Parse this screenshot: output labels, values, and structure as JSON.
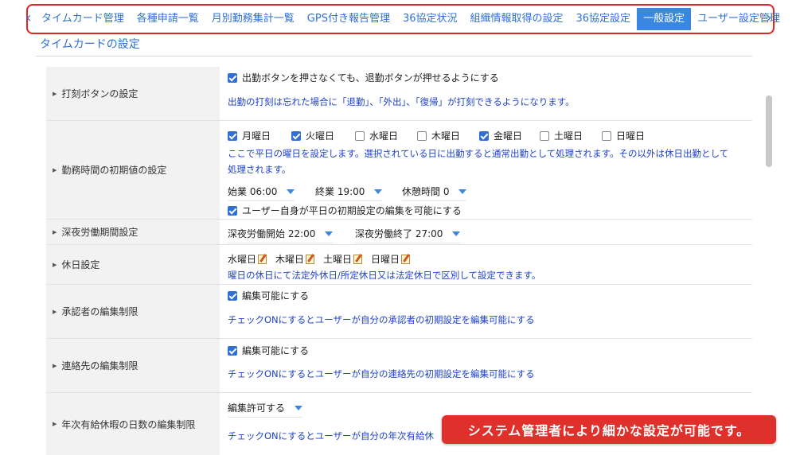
{
  "tabs": [
    {
      "label": "タイムカード管理",
      "active": false
    },
    {
      "label": "各種申請一覧",
      "active": false
    },
    {
      "label": "月別勤務集計一覧",
      "active": false
    },
    {
      "label": "GPS付き報告管理",
      "active": false
    },
    {
      "label": "36協定状況",
      "active": false
    },
    {
      "label": "組織情報取得の設定",
      "active": false
    },
    {
      "label": "36協定設定",
      "active": false
    },
    {
      "label": "一般設定",
      "active": true
    },
    {
      "label": "ユーザー設定管理",
      "active": false
    }
  ],
  "nav": {
    "left_icon": "chevron-left-icon",
    "right_icon": "chevron-right-icon"
  },
  "section_title": "タイムカードの設定",
  "rows": {
    "punch": {
      "label": "打刻ボタンの設定",
      "checkbox_label": "出勤ボタンを押さなくても、退勤ボタンが押せるようにする",
      "checked": true,
      "note": "出勤の打刻は忘れた場合に「退勤」、「外出」、「復帰」が打刻できるようになります。"
    },
    "worktime": {
      "label": "勤務時間の初期値の設定",
      "days": [
        {
          "label": "月曜日",
          "checked": true
        },
        {
          "label": "火曜日",
          "checked": true
        },
        {
          "label": "水曜日",
          "checked": false
        },
        {
          "label": "木曜日",
          "checked": false
        },
        {
          "label": "金曜日",
          "checked": true
        },
        {
          "label": "土曜日",
          "checked": false
        },
        {
          "label": "日曜日",
          "checked": false
        }
      ],
      "note_line1": "ここで平日の曜日を設定します。選択されている日に出勤すると通常出勤として処理されます。その以外は休日出勤として",
      "note_line2": "処理されます。",
      "start": "始業 06:00",
      "end": "終業 19:00",
      "break": "休憩時間 0",
      "user_edit_label": "ユーザー自身が平日の初期設定の編集を可能にする",
      "user_edit_checked": true
    },
    "night": {
      "label": "深夜労働期間設定",
      "start": "深夜労働開始 22:00",
      "end": "深夜労働終了 27:00"
    },
    "holiday": {
      "label": "休日設定",
      "days": [
        "水曜日",
        "木曜日",
        "土曜日",
        "日曜日"
      ],
      "note": "曜日の休日にて法定外休日/所定休日又は法定休日で区別して設定できます。"
    },
    "approver": {
      "label": "承認者の編集制限",
      "checkbox_label": "編集可能にする",
      "checked": true,
      "note": "チェックONにするとユーザーが自分の承認者の初期設定を編集可能にする"
    },
    "contact": {
      "label": "連絡先の編集制限",
      "checkbox_label": "編集可能にする",
      "checked": true,
      "note": "チェックONにするとユーザーが自分の連絡先の初期設定を編集可能にする"
    },
    "paidleave": {
      "label": "年次有給休暇の日数の編集制限",
      "select_value": "編集許可する",
      "note": "チェックONにするとユーザーが自分の年次有給休"
    }
  },
  "callout": "システム管理者により細かな設定が可能です。",
  "colors": {
    "accent": "#2f6fd6",
    "active_tab": "#3a87e0",
    "highlight": "#e02424",
    "callout": "#e0302b",
    "note": "#1f43c8"
  }
}
